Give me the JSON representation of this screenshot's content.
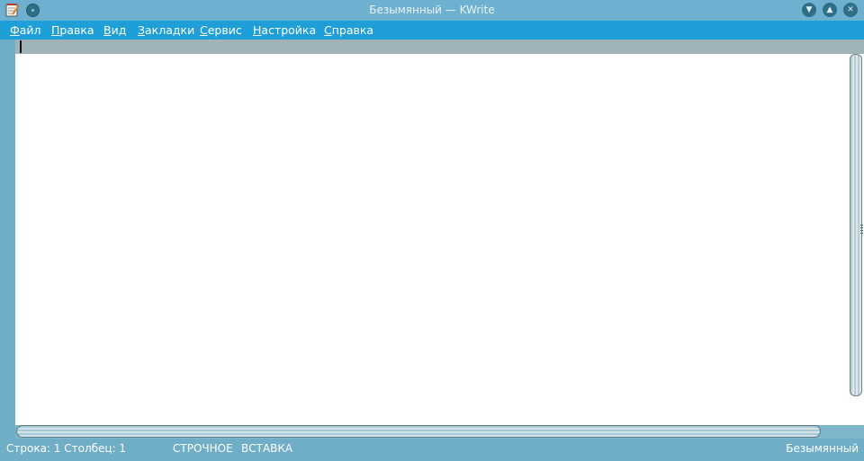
{
  "window": {
    "title": "Безымянный — KWrite",
    "app_icon": "kwrite-notepad-icon",
    "buttons": [
      "pin-icon",
      "minimize-icon",
      "maximize-icon",
      "close-icon"
    ]
  },
  "menu": {
    "items": [
      {
        "mnemonic": "Ф",
        "rest": "айл"
      },
      {
        "mnemonic": "П",
        "rest": "равка"
      },
      {
        "mnemonic": "В",
        "rest": "ид"
      },
      {
        "mnemonic": "З",
        "rest": "акладки"
      },
      {
        "mnemonic": "С",
        "rest": "ервис"
      },
      {
        "mnemonic": "Н",
        "rest": "астройка"
      },
      {
        "mnemonic": "С",
        "rest": "правка"
      }
    ]
  },
  "editor": {
    "content": ""
  },
  "status": {
    "position": "Строка: 1 Столбец: 1",
    "selection_mode": "СТРОЧНОЕ",
    "input_mode": "ВСТАВКА",
    "document_name": "Безымянный"
  },
  "colors": {
    "titlebar": "#6db0cf",
    "menubar": "#1f9fd8",
    "editor_bg": "#ffffff",
    "current_line": "#9fb3b8",
    "chrome": "#6faec6"
  }
}
